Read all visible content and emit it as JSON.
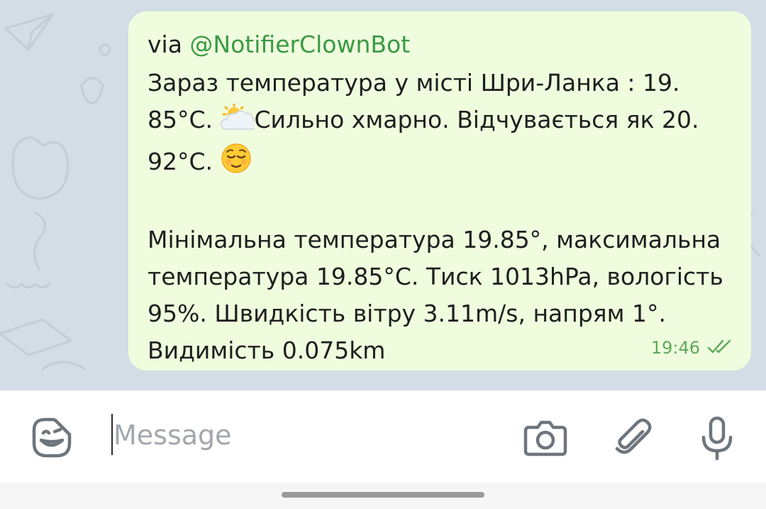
{
  "message": {
    "via_prefix": "via ",
    "via_handle": "@NotifierClownBot",
    "lines": [
      "Зараз температура у місті Шри-Ланка : 19.",
      "Сильно хмарно. Відчувається як 20."
    ],
    "temp_part": "85°C. ",
    "feels_part": "92°C. ",
    "details": "Мінімальна температура 19.85°, максимальна\nтемпература 19.85°C. Тиск 1013hPa, вологість\n95%. Швидкість вітру 3.11m/s, напрям 1°.\nВидимість 0.075km",
    "time": "19:46",
    "status_icon": "double-check-icon",
    "weather_icon": "sun-behind-cloud-icon",
    "mood_icon": "relieved-face-icon"
  },
  "composer": {
    "placeholder": "Message",
    "emoji_icon": "sticker-smile-icon",
    "camera_icon": "camera-icon",
    "attach_icon": "paperclip-icon",
    "mic_icon": "microphone-icon"
  },
  "colors": {
    "chat_background": "#d3dde6",
    "bubble": "#effdde",
    "handle_green": "#3a9a43",
    "time_green": "#5ea95a",
    "icon_gray": "#6e757c"
  }
}
